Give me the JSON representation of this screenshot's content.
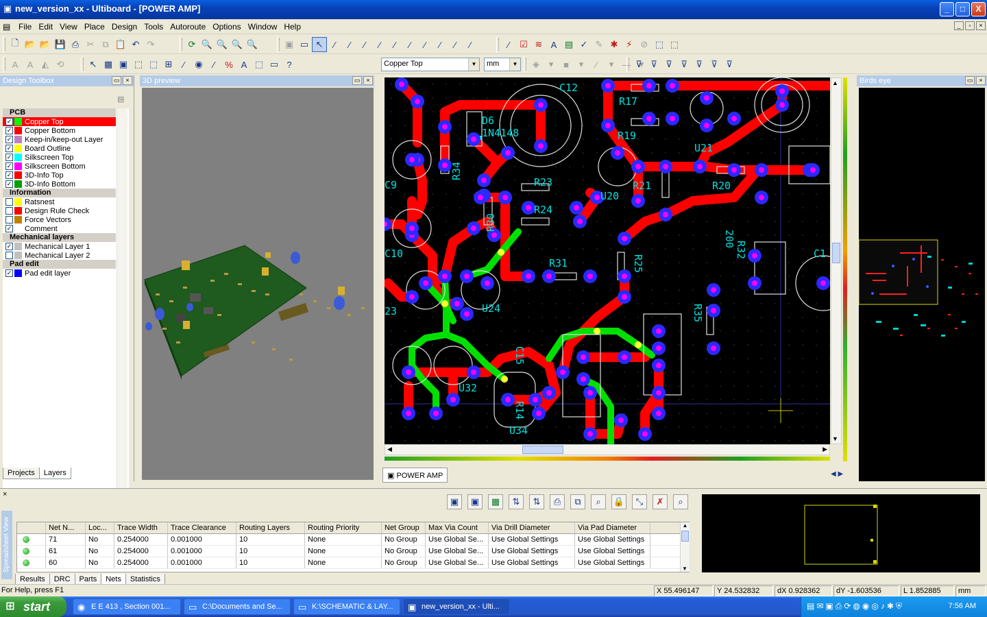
{
  "window": {
    "title": "new_version_xx - Ultiboard - [POWER AMP]",
    "minimize": "_",
    "maximize": "□",
    "close": "X"
  },
  "menu": [
    "File",
    "Edit",
    "View",
    "Place",
    "Design",
    "Tools",
    "Autoroute",
    "Options",
    "Window",
    "Help"
  ],
  "toolbar": {
    "layer_select": "Copper Top",
    "unit_select": "mm"
  },
  "toolbox": {
    "title": "Design Toolbox",
    "categories": [
      {
        "name": "PCB",
        "layers": [
          {
            "label": "Copper Top",
            "checked": true,
            "color": "#00ff00",
            "selected": true
          },
          {
            "label": "Copper Bottom",
            "checked": true,
            "color": "#ff0000"
          },
          {
            "label": "Keep-in/keep-out Layer",
            "checked": true,
            "color": "#c080c0"
          },
          {
            "label": "Board Outline",
            "checked": true,
            "color": "#ffff00"
          },
          {
            "label": "Silkscreen Top",
            "checked": true,
            "color": "#00ffff"
          },
          {
            "label": "Silkscreen Bottom",
            "checked": true,
            "color": "#ff00ff"
          },
          {
            "label": "3D-Info Top",
            "checked": true,
            "color": "#ff0000"
          },
          {
            "label": "3D-Info Bottom",
            "checked": true,
            "color": "#00a000"
          }
        ]
      },
      {
        "name": "Information",
        "layers": [
          {
            "label": "Ratsnest",
            "checked": false,
            "color": "#ffff00"
          },
          {
            "label": "Design Rule Check",
            "checked": false,
            "color": "#ff0000"
          },
          {
            "label": "Force Vectors",
            "checked": false,
            "color": "#c08000"
          },
          {
            "label": "Comment",
            "checked": true,
            "color": ""
          }
        ]
      },
      {
        "name": "Mechanical layers",
        "layers": [
          {
            "label": "Mechanical Layer 1",
            "checked": true,
            "color": "#c0c0c0"
          },
          {
            "label": "Mechanical Layer 2",
            "checked": false,
            "color": "#c0c0c0"
          }
        ]
      },
      {
        "name": "Pad edit",
        "layers": [
          {
            "label": "Pad edit layer",
            "checked": true,
            "color": "#0000ff"
          }
        ]
      }
    ],
    "tabs": [
      "Projects",
      "Layers"
    ]
  },
  "preview3d": {
    "title": "3D preview"
  },
  "editor": {
    "doc_tab": "POWER AMP",
    "labels": [
      "C12",
      "D6",
      "1N4148",
      "R17",
      "R19",
      "U21",
      "R34",
      "R23",
      "R24",
      "U20",
      "R21",
      "R20",
      "C9",
      "R30",
      "R31",
      "R25",
      "R32",
      "200",
      "C10",
      "C1",
      "U24",
      "R35",
      "C15",
      "U32",
      "23",
      "R14",
      "U34"
    ]
  },
  "birdseye": {
    "title": "Birds eye"
  },
  "spreadsheet": {
    "side_label": "Spreadsheet View",
    "columns": [
      "",
      "Net N...",
      "Loc...",
      "Trace Width",
      "Trace Clearance",
      "Routing Layers",
      "Routing Priority",
      "Net Group",
      "Max Via Count",
      "Via Drill Diameter",
      "Via Pad Diameter"
    ],
    "rows": [
      [
        "71",
        "No",
        "0.254000",
        "0.001000",
        "10",
        "None",
        "No Group",
        "Use Global Se...",
        "Use Global Settings",
        "Use Global Settings"
      ],
      [
        "61",
        "No",
        "0.254000",
        "0.001000",
        "10",
        "None",
        "No Group",
        "Use Global Se...",
        "Use Global Settings",
        "Use Global Settings"
      ],
      [
        "60",
        "No",
        "0.254000",
        "0.001000",
        "10",
        "None",
        "No Group",
        "Use Global Se...",
        "Use Global Settings",
        "Use Global Settings"
      ]
    ],
    "tabs": [
      "Results",
      "DRC",
      "Parts",
      "Nets",
      "Statistics"
    ],
    "active_tab": "Nets"
  },
  "status": {
    "help": "For Help, press F1",
    "x": "X 55.496147",
    "y": "Y 24.532832",
    "dx": "dX 0.928362",
    "dy": "dY -1.603536",
    "l": "L 1.852885",
    "unit": "mm"
  },
  "taskbar": {
    "start": "start",
    "items": [
      {
        "label": "E E 413 , Section 001...",
        "icon": "firefox-icon"
      },
      {
        "label": "C:\\Documents and Se...",
        "icon": "folder-icon"
      },
      {
        "label": "K:\\SCHEMATIC & LAY...",
        "icon": "folder-icon"
      },
      {
        "label": "new_version_xx - Ulti...",
        "icon": "ultiboard-icon"
      }
    ],
    "clock": "7:56 AM"
  }
}
